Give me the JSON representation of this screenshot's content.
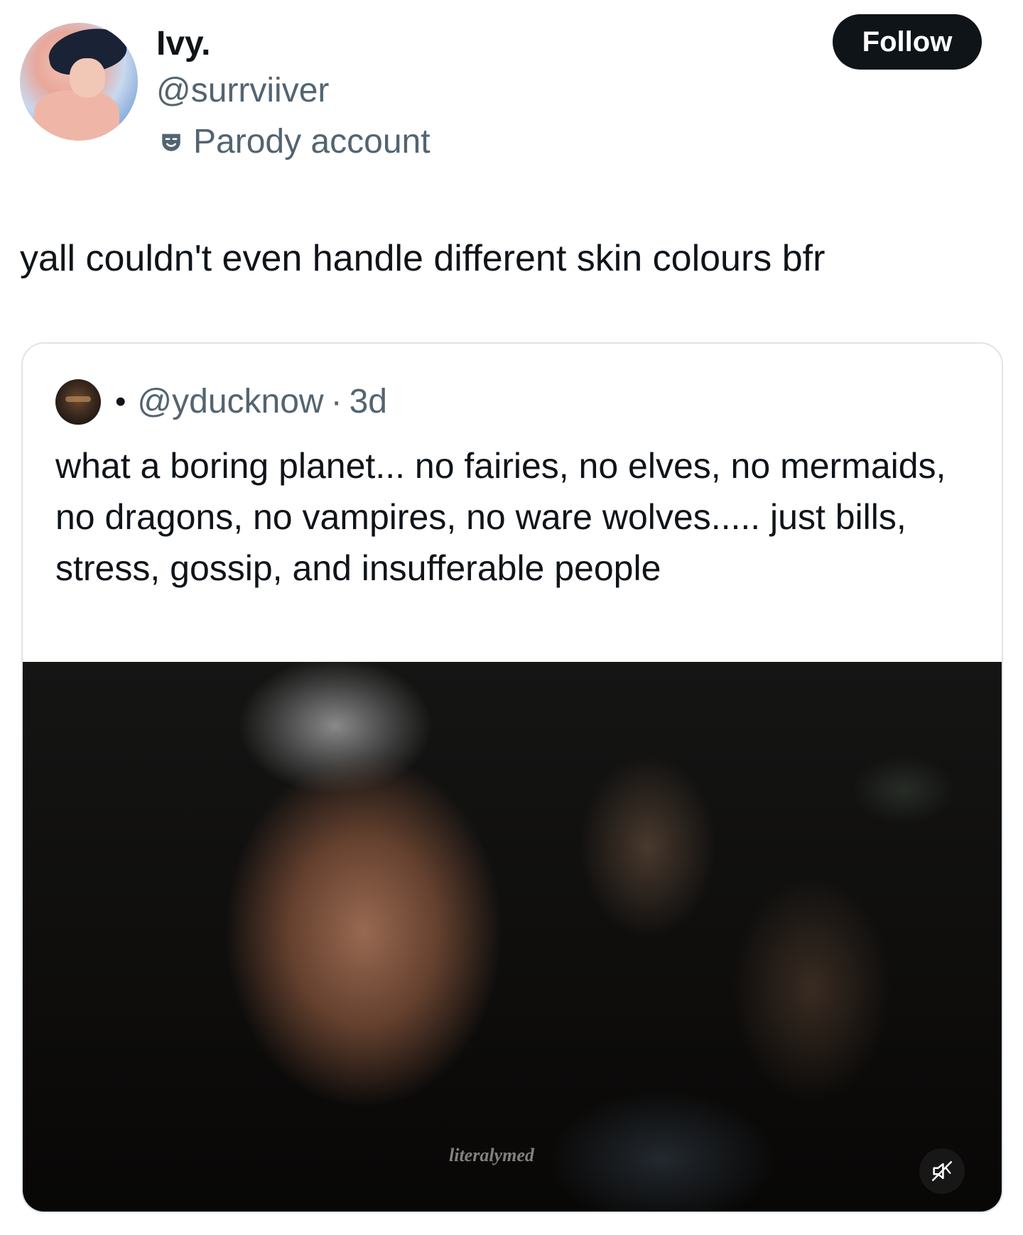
{
  "author": {
    "display_name": "Ivy.",
    "handle": "@surrviiver",
    "label_icon": "parody-mask-icon",
    "label": "Parody account"
  },
  "follow_button": {
    "label": "Follow"
  },
  "tweet": {
    "text": "yall couldn't even handle different skin colours bfr"
  },
  "quoted_tweet": {
    "dot": "•",
    "handle": "@yducknow",
    "separator": "·",
    "time": "3d",
    "text": "what a boring planet... no fairies, no elves, no mermaids, no dragons, no vampires, no ware wolves..... just bills, stress, gossip, and insufferable people",
    "media": {
      "watermark": "literalymed",
      "mute_icon": "speaker-muted-icon"
    }
  },
  "colors": {
    "text": "#0f1419",
    "secondary_text": "#536471",
    "follow_bg": "#0f1419",
    "border": "#dfe4e8"
  }
}
